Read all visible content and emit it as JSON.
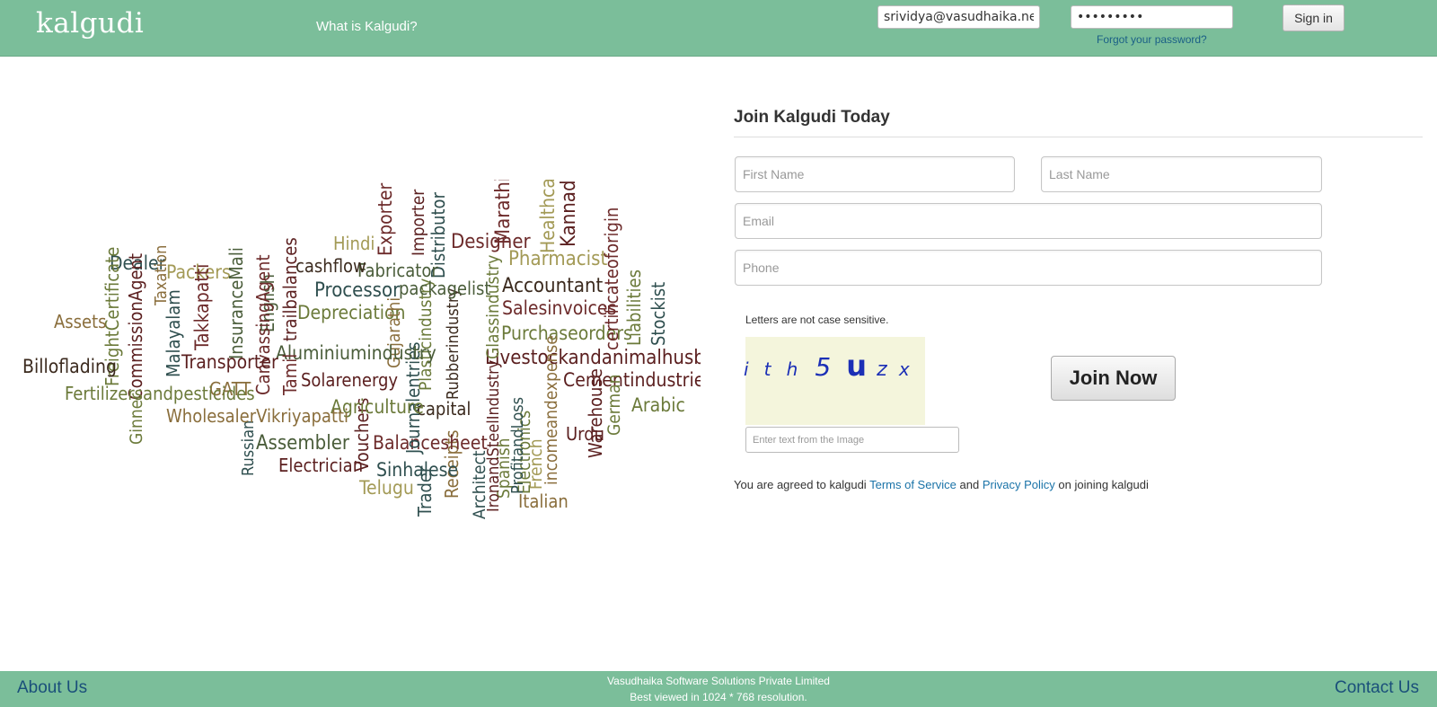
{
  "header": {
    "logo": "kalgudi",
    "nav_link": "What is Kalgudi?",
    "login_email_value": "srividya@vasudhaika.net",
    "login_password_value": "•••••••••",
    "forgot_password": "Forgot your password?",
    "sign_in": "Sign in"
  },
  "word_cloud": {
    "words": [
      "Dealer",
      "Packers",
      "Hindi",
      "Exporter",
      "Importer",
      "Designer",
      "Marathi",
      "Healthcare",
      "Kannada",
      "Pharmacist",
      "Accountant",
      "Salesinvoices",
      "Purchaseorders",
      "Livestockandanimalhusbandary",
      "Cementindustries",
      "Arabic",
      "German",
      "Warehouse",
      "Urdu",
      "Italian",
      "incomeandexpense",
      "French",
      "Electronics",
      "Spanish",
      "ProfitandLoss",
      "Architect",
      "IronandSteelIndustry",
      "Trader",
      "Receipts",
      "Rubberindustry",
      "Glassindustry",
      "Sinhalese",
      "Telugu",
      "Balancesheet",
      "Vouchers",
      "Journalentries",
      "Plasticindustry",
      "capital",
      "packagelist",
      "Distributor",
      "Fabricator",
      "cashflow",
      "Processor",
      "Depreciation",
      "Gujarathi",
      "Aluminiumindustry",
      "Solarenergy",
      "Agriculture",
      "Tamil",
      "trailbalances",
      "English",
      "CanvassingAgent",
      "InsuranceMali",
      "Transporter",
      "Assembler",
      "Electrician",
      "Russian",
      "WholesalerVikriyapatti",
      "GATT",
      "Takkapatti",
      "Malayalam",
      "Taxation",
      "CommissionAgent",
      "FreightCertificate",
      "Assets",
      "Billoflading",
      "Fertilizersandpesticides",
      "Ginner",
      "Stockist",
      "Liabilities",
      "certificateoforigin"
    ]
  },
  "signup": {
    "title": "Join Kalgudi Today",
    "first_name_placeholder": "First Name",
    "last_name_placeholder": "Last Name",
    "email_placeholder": "Email",
    "phone_placeholder": "Phone",
    "captcha_note": "Letters are not case sensitive.",
    "captcha_chars": [
      "i",
      "t",
      "h",
      "5",
      "u",
      "z",
      "x"
    ],
    "captcha_input_placeholder": "Enter text from the Image",
    "join_button": "Join Now",
    "agree_prefix": "You are agreed to kalgudi",
    "terms_link": "Terms of Service",
    "agree_and": "and",
    "privacy_link": "Privacy Policy",
    "agree_suffix": "on joining kalgudi"
  },
  "footer": {
    "about": "About Us",
    "company": "Vasudhaika Software Solutions Private Limited",
    "resolution": "Best viewed in 1024 * 768 resolution.",
    "contact": "Contact Us"
  },
  "colors": {
    "header_bg": "#7bbe9a",
    "link": "#1a73a8",
    "captcha_text": "#1b2fb6"
  }
}
